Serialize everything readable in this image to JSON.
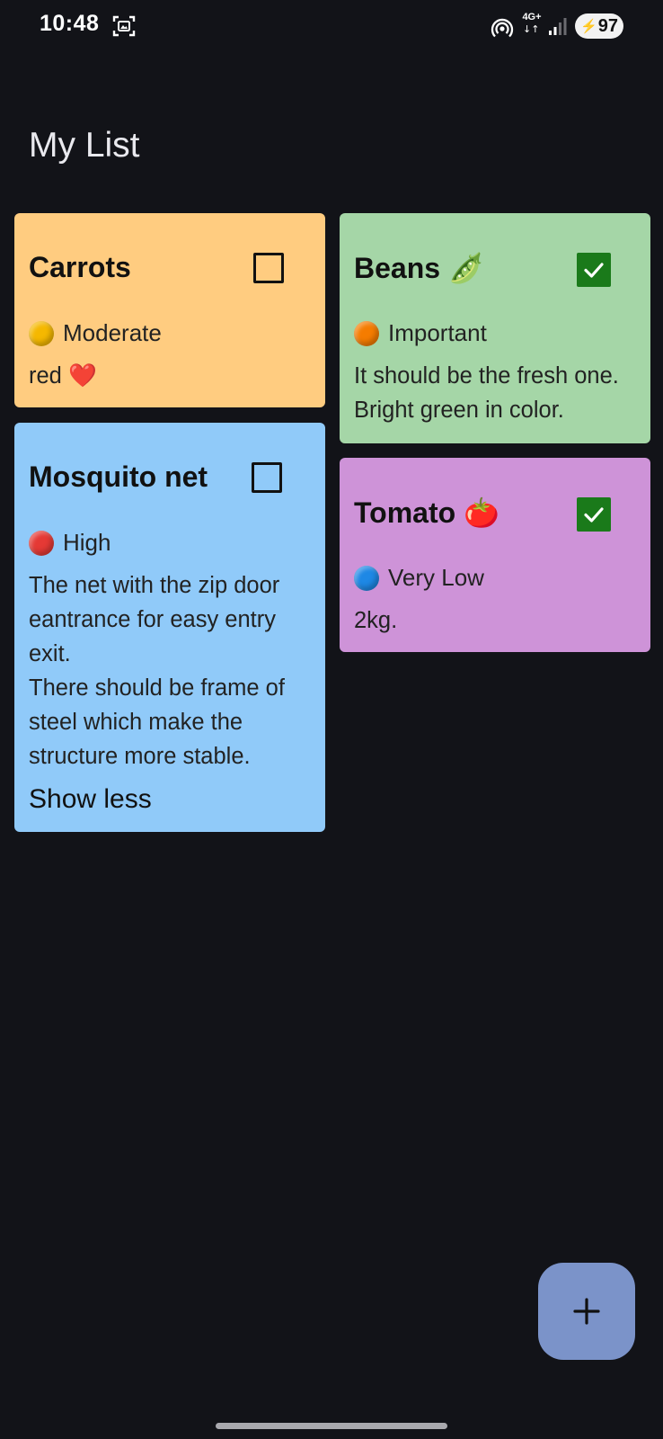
{
  "status_bar": {
    "time": "10:48",
    "network": "4G+",
    "network_arrows": "↓↑",
    "battery": "97"
  },
  "page": {
    "title": "My List"
  },
  "cards": [
    {
      "title": "Carrots",
      "checked": false,
      "priority": "Moderate",
      "priority_color": "#f5b800",
      "description": "red ❤️",
      "background": "#ffcc80"
    },
    {
      "title": "Beans 🫛",
      "checked": true,
      "priority": "Important",
      "priority_color": "#f57c00",
      "description": "It should be the fresh one.\nBright green in color.",
      "background": "#a5d6a7"
    },
    {
      "title": "Mosquito net",
      "checked": false,
      "priority": "High",
      "priority_color": "#e53935",
      "description": "The net with the zip door eantrance for easy entry exit.\nThere should be frame of steel which make the structure more stable.",
      "toggle": "Show less",
      "background": "#90caf9"
    },
    {
      "title": "Tomato 🍅",
      "checked": true,
      "priority": "Very Low",
      "priority_color": "#1e88e5",
      "description": "2kg.",
      "background": "#ce93d8"
    }
  ],
  "fab": {
    "icon": "plus-icon"
  }
}
